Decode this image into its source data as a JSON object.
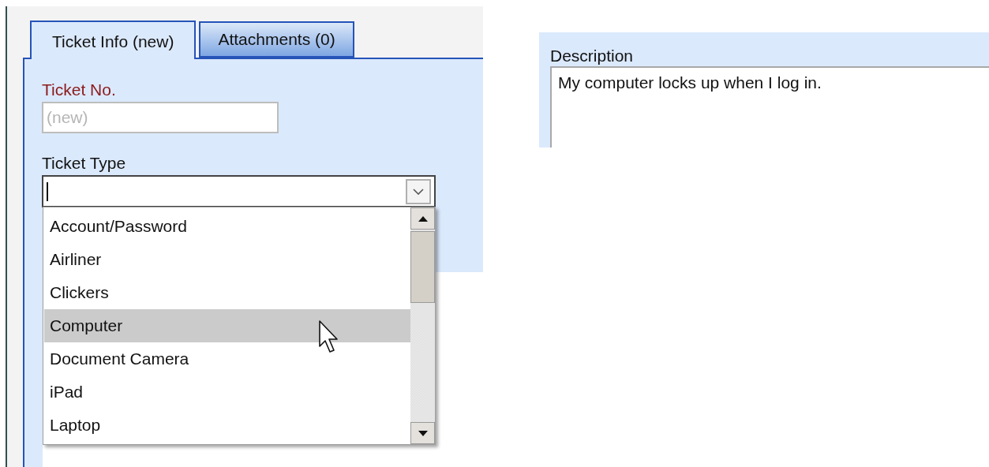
{
  "tabs": [
    {
      "label": "Ticket Info (new)",
      "selected": true
    },
    {
      "label": "Attachments (0)",
      "selected": false
    }
  ],
  "ticket_no": {
    "label": "Ticket No.",
    "required": true,
    "placeholder": "(new)"
  },
  "ticket_type": {
    "label": "Ticket Type",
    "options": [
      {
        "label": "Account/Password",
        "selected": false
      },
      {
        "label": "Airliner",
        "selected": false
      },
      {
        "label": "Clickers",
        "selected": false
      },
      {
        "label": "Computer",
        "selected": true
      },
      {
        "label": "Document Camera",
        "selected": false
      },
      {
        "label": "iPad",
        "selected": false
      },
      {
        "label": "Laptop",
        "selected": false
      }
    ]
  },
  "description": {
    "label": "Description",
    "value": "My computer locks up when I log in."
  }
}
